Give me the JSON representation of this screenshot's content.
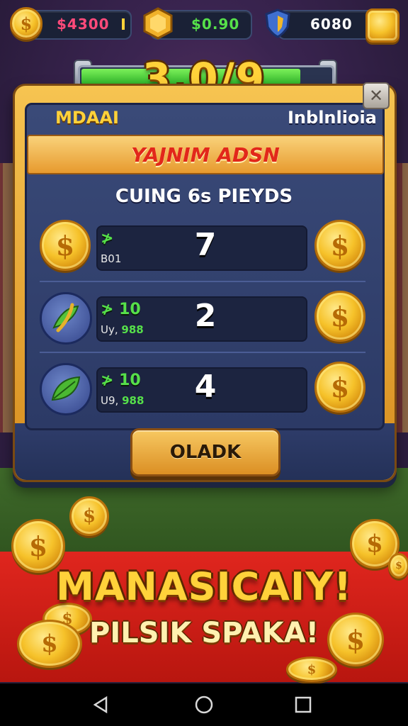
{
  "hud": {
    "coins_value": "$4300",
    "gems_value": "$0.90",
    "shield_value": "6080"
  },
  "progress": {
    "label": "3.0/9",
    "fraction": 0.88
  },
  "panel": {
    "header_left": "MDAAI",
    "header_right": "Inblnlioia",
    "ribbon": "YAJNIM ADSN",
    "subtitle": "CUING 6s PIEYDS",
    "close_glyph": "✕",
    "rows": [
      {
        "icon": "coin-icon",
        "amount": "≯",
        "sub": "B01",
        "sub_extra": "",
        "number": "7"
      },
      {
        "icon": "banana-leaf-icon",
        "amount": "≯ 10",
        "sub": "Uy,",
        "sub_extra": "988",
        "number": "2"
      },
      {
        "icon": "leaf-icon",
        "amount": "≯ 10",
        "sub": "U9,",
        "sub_extra": "988",
        "number": "4"
      }
    ],
    "claim_label": "OLADK"
  },
  "promo": {
    "line1": "MANASICAIY!",
    "line2": "PILSIK SPAKA!"
  },
  "colors": {
    "gold": "#ffd23a",
    "green": "#56e04a",
    "banner_red": "#e0261e",
    "panel_blue": "#2c3a66"
  }
}
